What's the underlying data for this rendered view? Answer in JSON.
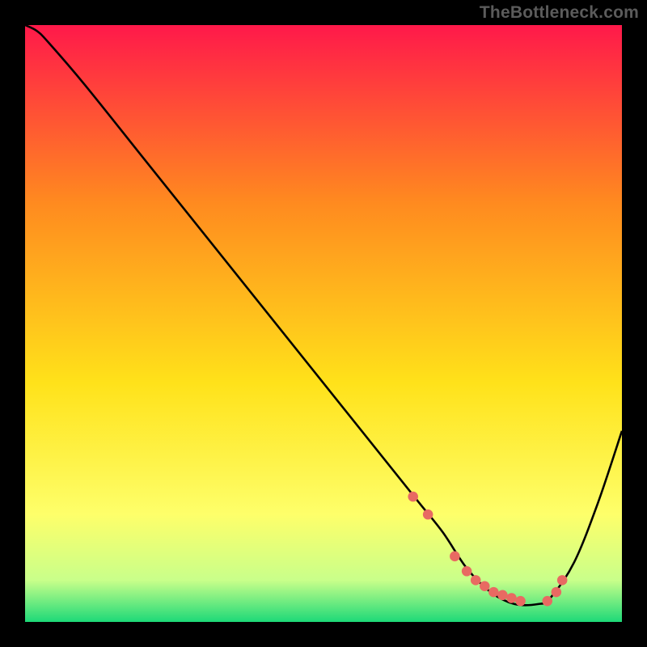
{
  "watermark": "TheBottleneck.com",
  "colors": {
    "gradient_top": "#ff194a",
    "gradient_mid1": "#ff8b1f",
    "gradient_mid2": "#ffe21a",
    "gradient_mid3": "#feff6a",
    "gradient_mid4": "#c9ff8a",
    "gradient_bottom": "#1dd978",
    "curve": "#000000",
    "marker": "#e86a62"
  },
  "chart_data": {
    "type": "line",
    "title": "",
    "xlabel": "",
    "ylabel": "",
    "xlim": [
      0,
      100
    ],
    "ylim": [
      0,
      100
    ],
    "series": [
      {
        "name": "curve",
        "x": [
          0,
          2,
          4,
          10,
          20,
          30,
          40,
          50,
          60,
          66,
          70,
          74,
          78,
          82,
          86,
          88,
          92,
          96,
          100
        ],
        "y": [
          100,
          99,
          97,
          90,
          77.5,
          65,
          52.5,
          40,
          27.5,
          20,
          15,
          9,
          5,
          3,
          3,
          4,
          10,
          20,
          32
        ]
      }
    ],
    "markers": {
      "name": "highlight-points",
      "x": [
        65,
        67.5,
        72,
        74,
        75.5,
        77,
        78.5,
        80,
        81.5,
        83,
        87.5,
        89,
        90
      ],
      "y": [
        21,
        18,
        11,
        8.5,
        7,
        6,
        5,
        4.5,
        4,
        3.5,
        3.5,
        5,
        7
      ]
    }
  }
}
